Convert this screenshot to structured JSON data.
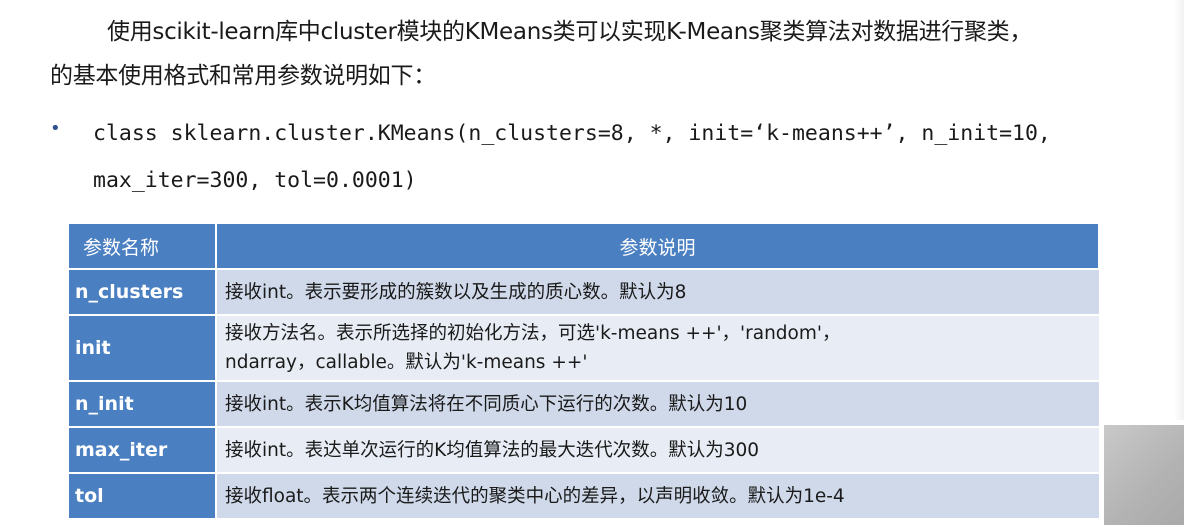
{
  "intro": {
    "line1": "使用scikit-learn库中cluster模块的KMeans类可以实现K-Means聚类算法对数据进行聚类，",
    "line2": "的基本使用格式和常用参数说明如下："
  },
  "code": {
    "bullet": "•",
    "line1": "class sklearn.cluster.KMeans(n_clusters=8, *, init=‘k-means++’, n_init=10,",
    "line2": "max_iter=300, tol=0.0001)"
  },
  "table": {
    "headers": [
      "参数名称",
      "参数说明"
    ],
    "rows": [
      {
        "name": "n_clusters",
        "desc": [
          "接收int。表示要形成的簇数以及生成的质心数。默认为8"
        ]
      },
      {
        "name": "init",
        "desc": [
          "接收方法名。表示所选择的初始化方法，可选'k-means ++'，'random'，",
          "ndarray，callable。默认为'k-means ++'"
        ]
      },
      {
        "name": "n_init",
        "desc": [
          "接收int。表示K均值算法将在不同质心下运行的次数。默认为10"
        ]
      },
      {
        "name": "max_iter",
        "desc": [
          "接收int。表达单次运行的K均值算法的最大迭代次数。默认为300"
        ]
      },
      {
        "name": "tol",
        "desc": [
          "接收float。表示两个连续迭代的聚类中心的差异，以声明收敛。默认为1e-4"
        ]
      }
    ]
  },
  "colors": {
    "header_bg": "#4a7fc1",
    "row_odd": "#cfd9ea",
    "row_even": "#e8edf5"
  }
}
